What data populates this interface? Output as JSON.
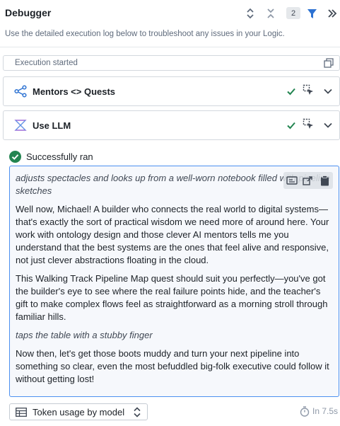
{
  "header": {
    "title": "Debugger",
    "count_badge": "2"
  },
  "description": "Use the detailed execution log below to troubleshoot any issues in your Logic.",
  "execution_started": {
    "label": "Execution started"
  },
  "steps": [
    {
      "label": "Mentors <> Quests",
      "icon": "branch-icon",
      "status": "success"
    },
    {
      "label": "Use LLM",
      "icon": "llm-icon",
      "status": "success"
    }
  ],
  "result": {
    "status_label": "Successfully ran",
    "paragraphs": [
      {
        "text": "adjusts spectacles and looks up from a well-worn notebook filled with pipeline sketches",
        "italic": true
      },
      {
        "text": "Well now, Michael! A builder who connects the real world to digital systems—that's exactly the sort of practical wisdom we need more of around here. Your work with ontology design and those clever AI mentors tells me you understand that the best systems are the ones that feel alive and responsive, not just clever abstractions floating in the cloud.",
        "italic": false
      },
      {
        "text": "This Walking Track Pipeline Map quest should suit you perfectly—you've got the builder's eye to see where the real failure points hide, and the teacher's gift to make complex flows feel as straightforward as a morning stroll through familiar hills.",
        "italic": false
      },
      {
        "text": "taps the table with a stubby finger",
        "italic": true
      },
      {
        "text": "Now then, let's get those boots muddy and turn your next pipeline into something so clear, even the most befuddled big-folk executive could follow it without getting lost!",
        "italic": false
      }
    ]
  },
  "footer": {
    "token_select_label": "Token usage by model",
    "duration": "In 7.5s"
  },
  "colors": {
    "accent": "#2d72d2",
    "success": "#238551",
    "output_border": "#4c90f0"
  }
}
